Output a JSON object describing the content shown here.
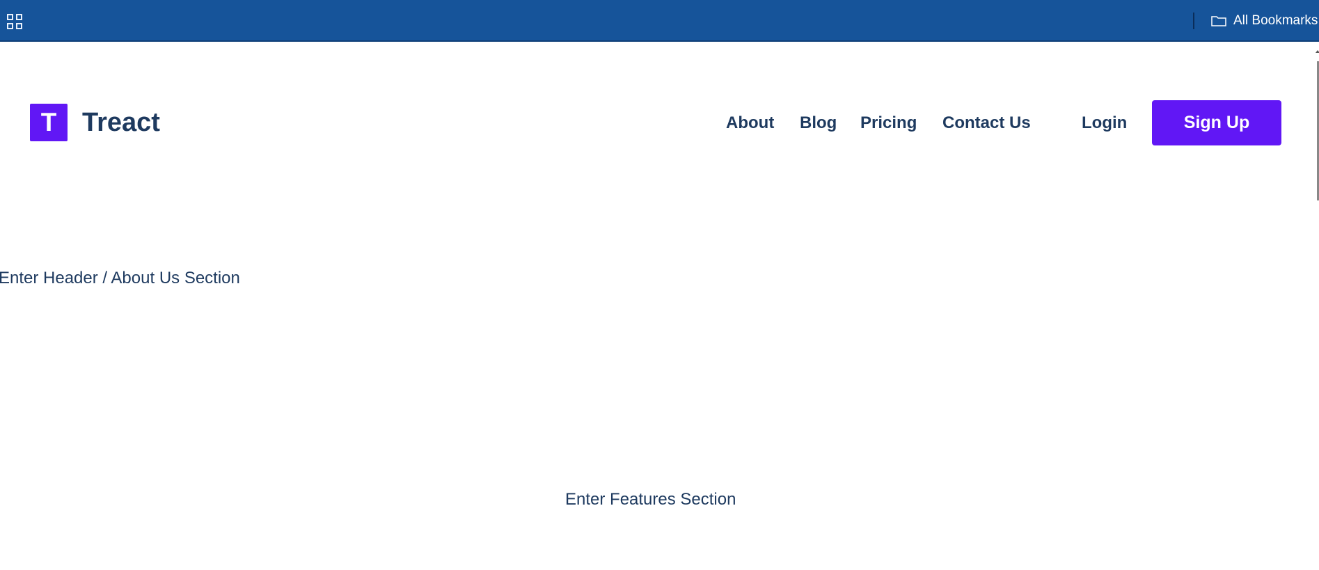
{
  "bookmarks_bar": {
    "apps_icon": "apps-grid-icon",
    "folder_icon": "folder-icon",
    "folder_label": "All Bookmarks",
    "background_color": "#16549a"
  },
  "site": {
    "logo_letter": "T",
    "brand_name": "Treact",
    "accent_color": "#6117f5",
    "text_color": "#1e3a5f"
  },
  "nav": {
    "items": [
      {
        "label": "About"
      },
      {
        "label": "Blog"
      },
      {
        "label": "Pricing"
      },
      {
        "label": "Contact Us"
      }
    ],
    "login_label": "Login",
    "signup_label": "Sign Up"
  },
  "sections": {
    "header_placeholder": "Enter Header / About Us Section",
    "features_placeholder": "Enter Features Section"
  }
}
